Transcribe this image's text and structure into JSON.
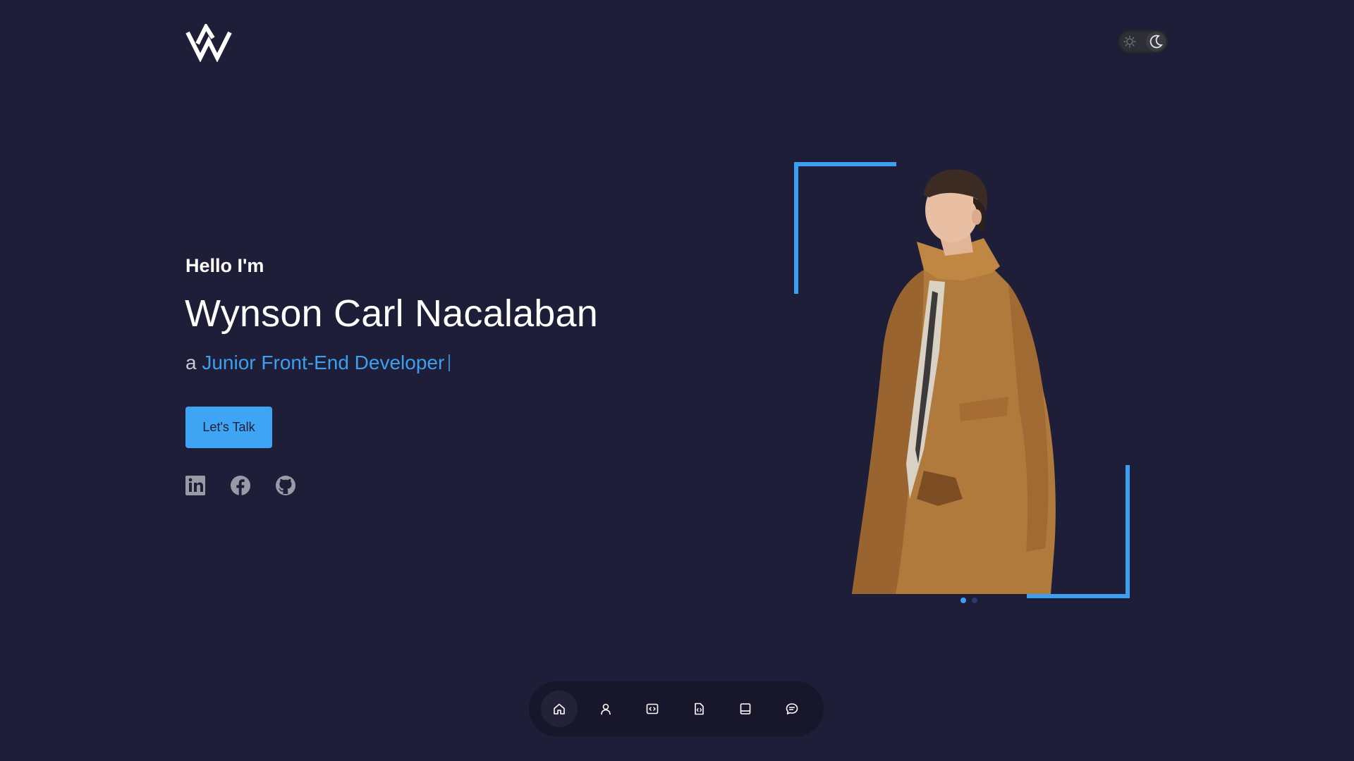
{
  "header": {
    "logo_icon": "w-monogram-logo",
    "theme_toggle": {
      "icons": [
        "sun-icon",
        "moon-icon"
      ],
      "mode": "dark"
    }
  },
  "hero": {
    "greeting": "Hello I'm",
    "name": "Wynson Carl Nacalaban",
    "role_prefix": "a",
    "role": "Junior Front-End Developer",
    "cta_label": "Let's Talk",
    "socials": [
      {
        "icon": "linkedin-icon"
      },
      {
        "icon": "facebook-icon"
      },
      {
        "icon": "github-icon"
      }
    ]
  },
  "portrait": {
    "carousel": {
      "count": 2,
      "active": 1
    }
  },
  "bottom_nav": {
    "items": [
      {
        "icon": "home-icon",
        "active": true
      },
      {
        "icon": "user-icon",
        "active": false
      },
      {
        "icon": "code-window-icon",
        "active": false
      },
      {
        "icon": "code-file-icon",
        "active": false
      },
      {
        "icon": "laptop-icon",
        "active": false
      },
      {
        "icon": "message-icon",
        "active": false
      }
    ]
  },
  "colors": {
    "background": "#1f1e39",
    "accent": "#3d9fef",
    "button": "#3da5f4",
    "nav_background": "#17162a",
    "muted_text": "#c7c8d4",
    "icon_gray": "#9a9aa6"
  }
}
